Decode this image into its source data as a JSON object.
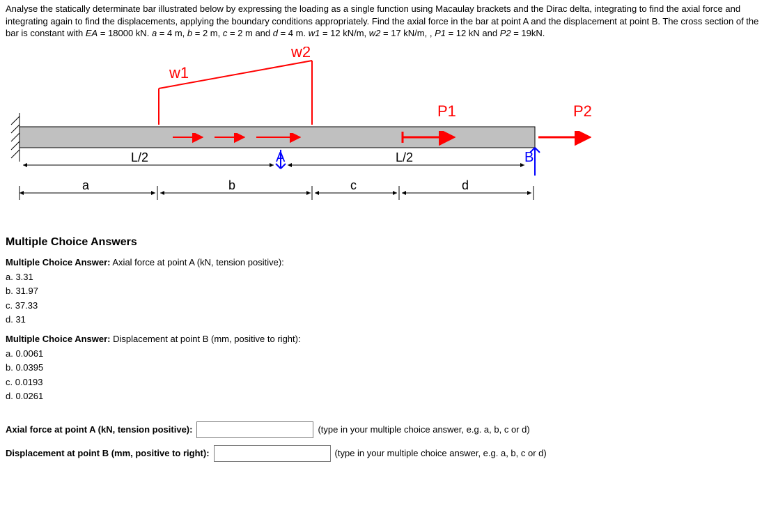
{
  "problem": {
    "text_html": "Analyse the statically determinate bar illustrated below by expressing the loading as a single function using Macaulay brackets and the Dirac delta, integrating to find the axial force and integrating again to find the displacements, applying the boundary conditions appropriately. Find the axial force in the bar at point A and the displacement at point B. The cross section of the bar is constant with <i>EA</i> = 18000 kN. <i>a</i> = 4 m, <i>b</i> = 2 m, <i>c</i> = 2 m and <i>d</i> = 4 m. <i>w1</i> = 12 kN/m, <i>w2</i> = 17 kN/m, , <i>P1</i> = 12 kN and <i>P2</i> = 19kN."
  },
  "diagram": {
    "labels": {
      "w1": "w1",
      "w2": "w2",
      "P1": "P1",
      "P2": "P2",
      "A": "A",
      "B": "B",
      "Lhalf1": "L/2",
      "Lhalf2": "L/2",
      "a": "a",
      "b": "b",
      "c": "c",
      "d": "d"
    },
    "colors": {
      "load": "#ff0000",
      "P2": "#ff0000",
      "bar_fill": "#c0c0c0",
      "bar_stroke": "#000000",
      "text_blue": "#0000ff",
      "dim": "#000000"
    }
  },
  "mc": {
    "heading": "Multiple Choice Answers",
    "q1": {
      "prompt_html": "<b>Multiple Choice Answer:</b> Axial force at point A (kN, tension positive):",
      "options": [
        "a. 3.31",
        "b. 31.97",
        "c. 37.33",
        "d. 31"
      ]
    },
    "q2": {
      "prompt_html": "<b>Multiple Choice Answer:</b> Displacement at point B (mm, positive to right):",
      "options": [
        "a. 0.0061",
        "b. 0.0395",
        "c. 0.0193",
        "d. 0.0261"
      ]
    }
  },
  "answers": {
    "row1": {
      "label": "Axial force at point A (kN, tension positive):",
      "hint": "(type in your multiple choice answer, e.g. a, b, c or d)",
      "value": ""
    },
    "row2": {
      "label": "Displacement at point B (mm, positive to right):",
      "hint": "(type in your multiple choice answer, e.g. a, b, c or d)",
      "value": ""
    }
  }
}
